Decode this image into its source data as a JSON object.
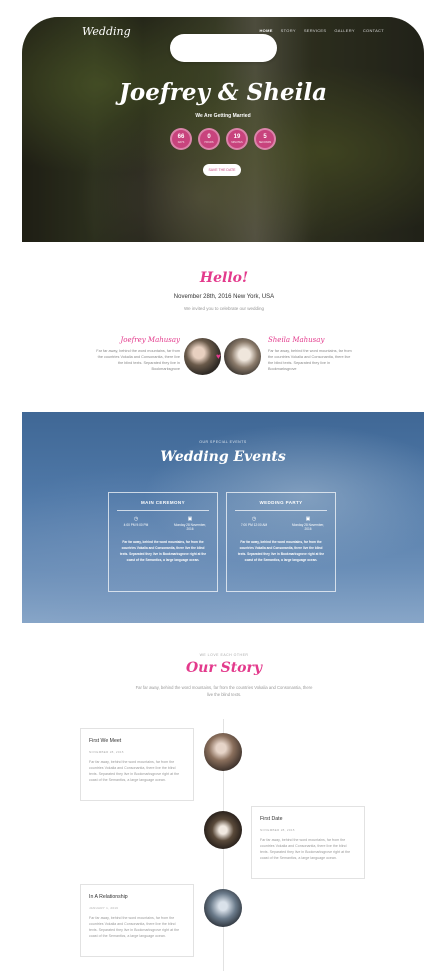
{
  "hero": {
    "logo": "Wedding",
    "nav": [
      "HOME",
      "STORY",
      "SERVICES",
      "GALLERY",
      "CONTACT"
    ],
    "title": "Joefrey & Sheila",
    "subtitle": "We Are Getting Married",
    "countdown": [
      {
        "value": "66",
        "unit": "DAYS"
      },
      {
        "value": "0",
        "unit": "HOURS"
      },
      {
        "value": "19",
        "unit": "MINUTES"
      },
      {
        "value": "5",
        "unit": "SECONDS"
      }
    ],
    "save_button": "SAVE THE DATE"
  },
  "hello": {
    "title": "Hello!",
    "date": "November 28th, 2016 New York, USA",
    "invite": "We invited you to celebrate our wedding",
    "groom": {
      "name": "Joefrey Mahusay",
      "text": "Far far away, behind the word mountains, far from the countries Vokalia and Consonantia, there live the blind texts. Separated they live in Bookmarksgrove"
    },
    "bride": {
      "name": "Sheila Mahusay",
      "text": "Far far away, behind the word mountains, far from the countries Vokalia and Consonantia, there live the blind texts. Separated they live in Bookmarksgrove"
    }
  },
  "events": {
    "kicker": "OUR SPECIAL EVENTS",
    "title": "Wedding Events",
    "boxes": [
      {
        "title": "MAIN CEREMONY",
        "time": "4:00 PM 9:00 PM",
        "date": "Monday 28 November, 2016",
        "desc": "Far far away, behind the word mountains, far from the countries Vokalia and Consonantia, there live the blind texts. Separated they live in Bookmarksgrove right at the coast of the Semantics, a large language ocean."
      },
      {
        "title": "WEDDING PARTY",
        "time": "7:00 PM 12:00 AM",
        "date": "Monday 28 November, 2016",
        "desc": "Far far away, behind the word mountains, far from the countries Vokalia and Consonantia, there live the blind texts. Separated they live in Bookmarksgrove right at the coast of the Semantics, a large language ocean."
      }
    ]
  },
  "story": {
    "kicker": "WE LOVE EACH OTHER",
    "title": "Our Story",
    "intro": "Far far away, behind the word mountains, far from the countries Vokalia and Consonantia, there live the blind texts.",
    "items": [
      {
        "title": "First We Meet",
        "date": "NOVEMBER 28, 2015",
        "text": "Far far away, behind the word mountains, far from the countries Vokalia and Consonantia, there live the blind texts. Separated they live in Bookmarksgrove right at the coast of the Semantics, a large language ocean."
      },
      {
        "title": "First Date",
        "date": "NOVEMBER 28, 2015",
        "text": "Far far away, behind the word mountains, far from the countries Vokalia and Consonantia, there live the blind texts. Separated they live in Bookmarksgrove right at the coast of the Semantics, a large language ocean."
      },
      {
        "title": "In A Relationship",
        "date": "JANUARY 1, 2016",
        "text": "Far far away, behind the word mountains, far from the countries Vokalia and Consonantia, there live the blind texts. Separated they live in Bookmarksgrove right at the coast of the Semantics, a large language ocean."
      }
    ]
  },
  "colors": {
    "accent": "#e33a8c",
    "countdown": "#c8437d",
    "events_bg": "#4f78a6"
  },
  "icons": {
    "time": "clock-icon",
    "date": "calendar-icon",
    "heart": "heart-icon"
  }
}
